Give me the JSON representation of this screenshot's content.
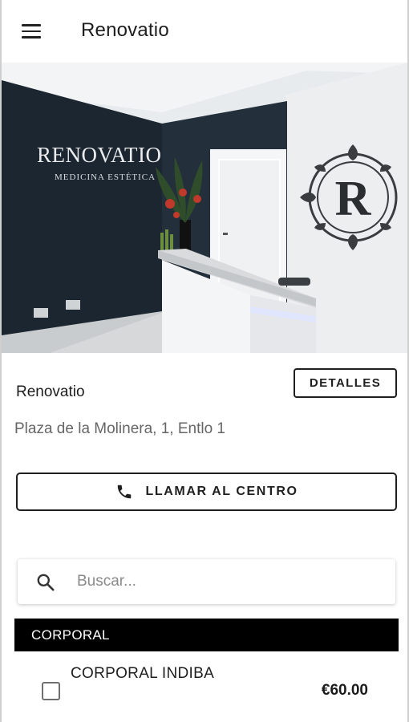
{
  "app_bar": {
    "title": "Renovatio",
    "menu_icon": "hamburger-menu-icon"
  },
  "hero": {
    "wall_sign_brand": "RENOVATIO",
    "wall_sign_tagline": "MEDICINA ESTÉTICA",
    "monogram": "R"
  },
  "business": {
    "name": "Renovatio",
    "address": "Plaza de la Molinera, 1, Entlo 1",
    "details_label": "DETALLES"
  },
  "call": {
    "label": "LLAMAR AL CENTRO",
    "icon": "phone-icon"
  },
  "search": {
    "placeholder": "Buscar...",
    "value": "",
    "icon": "search-icon"
  },
  "categories": [
    {
      "name": "CORPORAL",
      "services": [
        {
          "name": "CORPORAL INDIBA",
          "price": "€60.00",
          "checked": false
        }
      ]
    }
  ],
  "colors": {
    "accent": "#000000",
    "wall_dark": "#1e2a33",
    "background": "#ffffff"
  }
}
